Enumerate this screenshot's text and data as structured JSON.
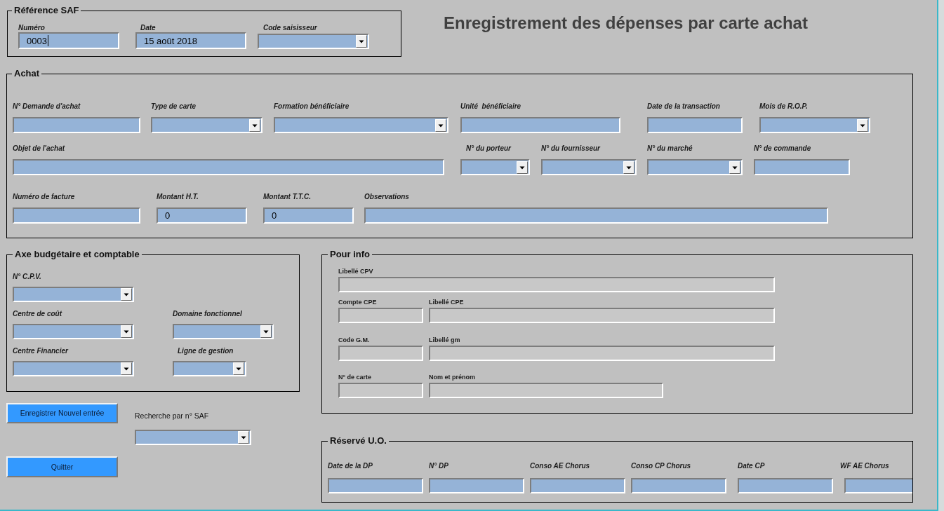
{
  "title": "Enregistrement des dépenses par carte achat",
  "reference_saf": {
    "legend": "Référence SAF",
    "fields": [
      {
        "label": "Numéro",
        "kind": "text",
        "value": "0003",
        "focused": true
      },
      {
        "label": "Date",
        "kind": "text",
        "value": "15 août 2018",
        "focused": false
      },
      {
        "label": "Code saisisseur",
        "kind": "combo",
        "focused": false
      }
    ]
  },
  "achat": {
    "legend": "Achat",
    "rows": [
      {
        "fields": [
          {
            "label": "N° Demande d'achat",
            "kind": "text"
          },
          {
            "label": "Type de carte",
            "kind": "combo"
          },
          {
            "label": "Formation bénéficiaire",
            "kind": "combo"
          },
          {
            "label": "Unité  bénéficiaire",
            "kind": "text"
          },
          {
            "label": "Date de la transaction",
            "kind": "text"
          },
          {
            "label": "Mois de R.O.P.",
            "kind": "combo"
          }
        ]
      },
      {
        "fields": [
          {
            "label": "Objet de l'achat",
            "kind": "text"
          },
          {
            "label": "N° du porteur",
            "kind": "combo"
          },
          {
            "label": "N° du fournisseur",
            "kind": "combo"
          },
          {
            "label": "N° du marché",
            "kind": "combo"
          },
          {
            "label": "N° de commande",
            "kind": "text"
          }
        ]
      },
      {
        "fields": [
          {
            "label": "Numéro de facture",
            "kind": "text"
          },
          {
            "label": "Montant H.T.",
            "kind": "text",
            "value": "0"
          },
          {
            "label": "Montant T.T.C.",
            "kind": "text",
            "value": "0"
          },
          {
            "label": "Observations",
            "kind": "text"
          }
        ]
      }
    ]
  },
  "axe_budgetaire": {
    "legend": "Axe budgétaire et comptable",
    "rows": [
      {
        "fields": [
          {
            "label": "N° C.P.V.",
            "kind": "combo"
          }
        ]
      },
      {
        "fields": [
          {
            "label": "Centre de coût",
            "kind": "combo"
          },
          {
            "label": "Domaine fonctionnel",
            "kind": "combo"
          }
        ]
      },
      {
        "fields": [
          {
            "label": "Centre Financier",
            "kind": "combo"
          },
          {
            "label": "Ligne de gestion",
            "kind": "combo"
          }
        ]
      }
    ]
  },
  "buttons": [
    "Enregistrer Nouvel entrée",
    "Quitter"
  ],
  "search": {
    "label": "Recherche par n° SAF",
    "kind": "combo"
  },
  "pour_info": {
    "legend": "Pour info",
    "rows": [
      {
        "fields": [
          {
            "label": "Libellé CPV",
            "kind": "text",
            "disabled": true
          }
        ]
      },
      {
        "fields": [
          {
            "label": "Compte CPE",
            "kind": "text",
            "disabled": true
          },
          {
            "label": "Libellé CPE",
            "kind": "text",
            "disabled": true
          }
        ]
      },
      {
        "fields": [
          {
            "label": "Code G.M.",
            "kind": "text",
            "disabled": true
          },
          {
            "label": "Libellé gm",
            "kind": "text",
            "disabled": true
          }
        ]
      },
      {
        "fields": [
          {
            "label": "N° de carte",
            "kind": "text",
            "disabled": true
          },
          {
            "label": "Nom et prénom",
            "kind": "text",
            "disabled": true
          }
        ]
      }
    ]
  },
  "reserve_uo": {
    "legend": "Réservé U.O.",
    "fields": [
      {
        "label": "Date de la DP",
        "kind": "text"
      },
      {
        "label": "N° DP",
        "kind": "text"
      },
      {
        "label": "Conso AE Chorus",
        "kind": "text"
      },
      {
        "label": "Conso CP Chorus",
        "kind": "text"
      },
      {
        "label": "Date CP",
        "kind": "text"
      },
      {
        "label": "WF AE Chorus",
        "kind": "text"
      }
    ]
  }
}
